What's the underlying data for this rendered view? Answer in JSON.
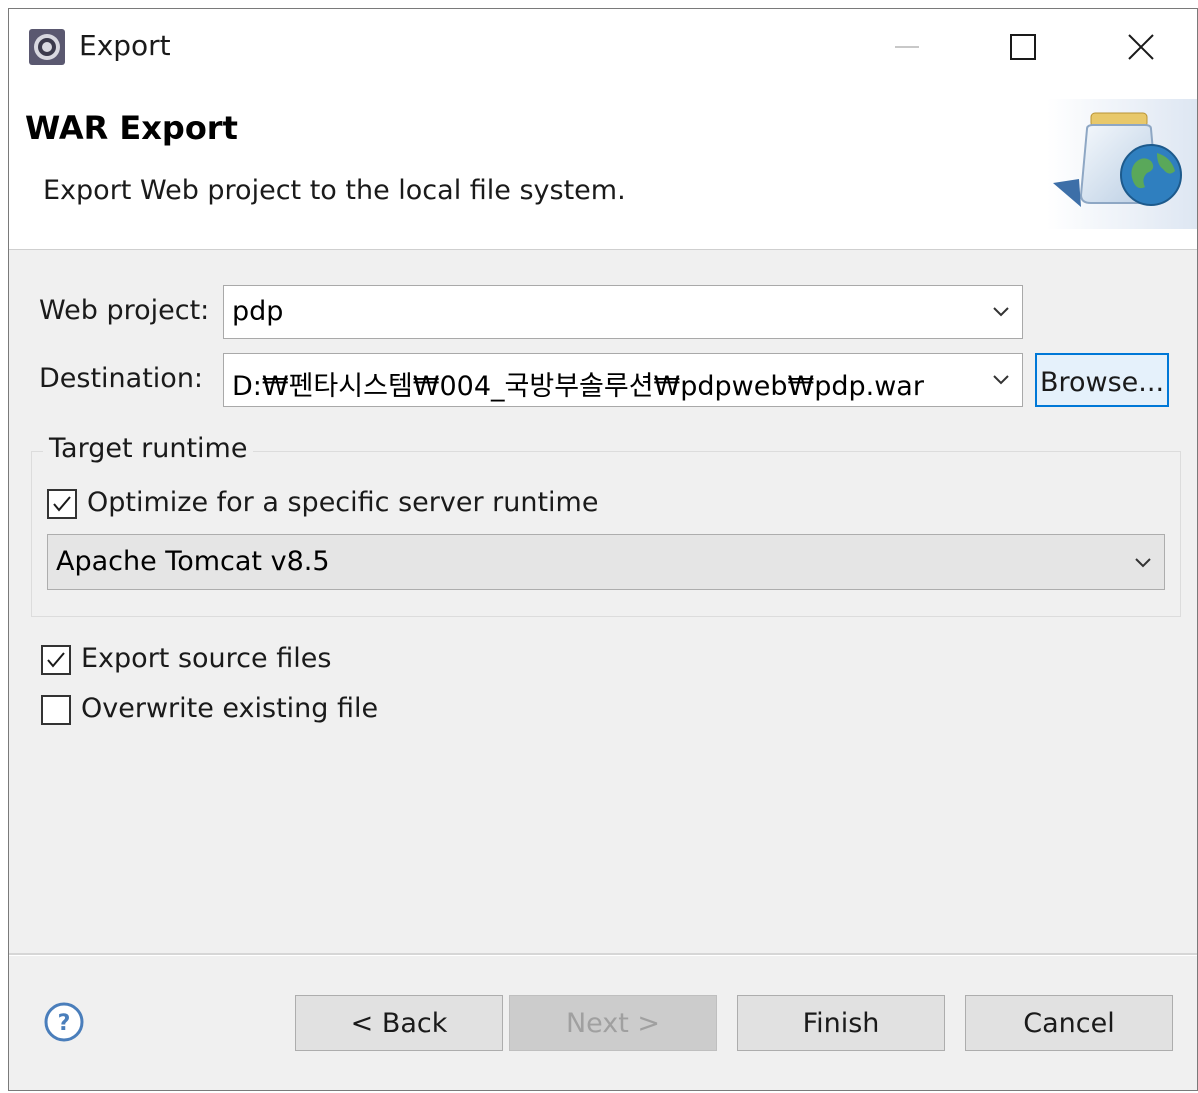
{
  "window": {
    "title": "Export",
    "controls": [
      "minimize-icon",
      "maximize-icon",
      "close-icon"
    ]
  },
  "header": {
    "title": "WAR Export",
    "description": "Export Web project to the local file system.",
    "banner_icon": "jar-globe-icon"
  },
  "form": {
    "web_project_label": "Web project:",
    "web_project_value": "pdp",
    "destination_label": "Destination:",
    "destination_value": "D:₩펜타시스템₩004_국방부솔루션₩pdpweb₩pdp.war",
    "browse_label": "Browse..."
  },
  "target_runtime": {
    "group_label": "Target runtime",
    "optimize_label": "Optimize for a specific server runtime",
    "optimize_checked": true,
    "runtime_value": "Apache Tomcat v8.5"
  },
  "options": {
    "export_source_label": "Export source files",
    "export_source_checked": true,
    "overwrite_label": "Overwrite existing file",
    "overwrite_checked": false
  },
  "footer": {
    "help_icon": "help-icon",
    "back_label": "< Back",
    "next_label": "Next >",
    "finish_label": "Finish",
    "cancel_label": "Cancel"
  },
  "colors": {
    "dialog_bg": "#f0f0f0",
    "default_button_border": "#0078d7",
    "help_icon": "#4a7ebb"
  }
}
